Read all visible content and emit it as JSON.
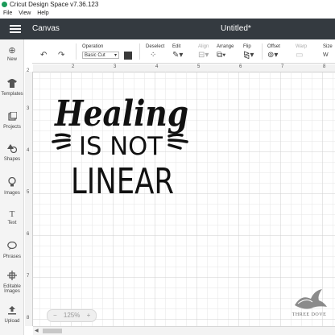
{
  "titlebar": {
    "title": "Cricut Design Space  v7.36.123"
  },
  "menubar": {
    "items": [
      "File",
      "View",
      "Help"
    ]
  },
  "appbar": {
    "section": "Canvas",
    "document_title": "Untitled*"
  },
  "sidebar": {
    "items": [
      {
        "label": "New",
        "icon": "plus-icon"
      },
      {
        "label": "Templates",
        "icon": "shirt-icon"
      },
      {
        "label": "Projects",
        "icon": "projects-icon"
      },
      {
        "label": "Shapes",
        "icon": "shapes-icon"
      },
      {
        "label": "Images",
        "icon": "lightbulb-icon"
      },
      {
        "label": "Text",
        "icon": "text-icon"
      },
      {
        "label": "Phrases",
        "icon": "speech-bubble-icon"
      },
      {
        "label": "Editable Images",
        "icon": "editable-images-icon"
      },
      {
        "label": "Upload",
        "icon": "upload-icon"
      }
    ]
  },
  "toolbar": {
    "operation_label": "Operation",
    "operation_value": "Basic Cut",
    "deselect_label": "Deselect",
    "edit_label": "Edit",
    "align_label": "Align",
    "arrange_label": "Arrange",
    "flip_label": "Flip",
    "offset_label": "Offset",
    "warp_label": "Warp",
    "size_label": "Size",
    "colors": {
      "swatch": "#3a3a3a"
    }
  },
  "rulers": {
    "top": [
      "2",
      "3",
      "4",
      "5",
      "6",
      "7",
      "8"
    ],
    "left": [
      "2",
      "3",
      "4",
      "5",
      "6",
      "7",
      "8"
    ]
  },
  "artwork": {
    "line1": "Healing",
    "line2": "IS NOT",
    "line3": "LINEAR"
  },
  "zoom": {
    "minus": "−",
    "value": "125%",
    "plus": "+"
  },
  "watermark": {
    "text": "THREE DOVE"
  }
}
